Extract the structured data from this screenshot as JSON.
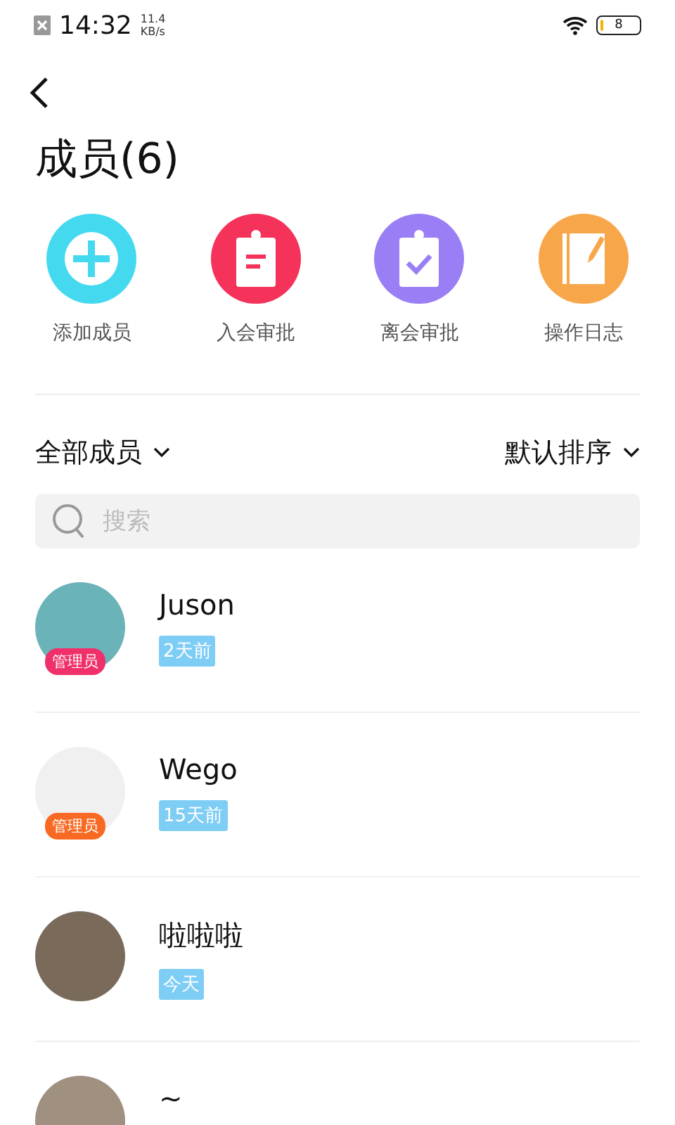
{
  "status_bar": {
    "time": "14:32",
    "speed": "11.4",
    "speed_unit": "KB/s",
    "battery": "8",
    "level": 0.08
  },
  "title": "成员(6)",
  "actions": [
    {
      "kind": "add",
      "label": "添加成员",
      "color": "#45d9f0"
    },
    {
      "kind": "join",
      "label": "入会审批",
      "color": "#f4325a"
    },
    {
      "kind": "leave",
      "label": "离会审批",
      "color": "#9a7ef5"
    },
    {
      "kind": "log",
      "label": "操作日志",
      "color": "#f8a64a"
    }
  ],
  "filter": {
    "label": "全部成员"
  },
  "sort": {
    "label": "默认排序"
  },
  "search": {
    "placeholder": "搜索"
  },
  "members": [
    {
      "name": "Juson",
      "last_seen": "2天前",
      "badge": {
        "label": "管理员",
        "color": "#f0306a"
      }
    },
    {
      "name": "Wego",
      "last_seen": "15天前",
      "badge": {
        "label": "管理员",
        "color": "#f86a24"
      }
    },
    {
      "name": "啦啦啦",
      "last_seen": "今天"
    },
    {
      "name": "~"
    }
  ]
}
